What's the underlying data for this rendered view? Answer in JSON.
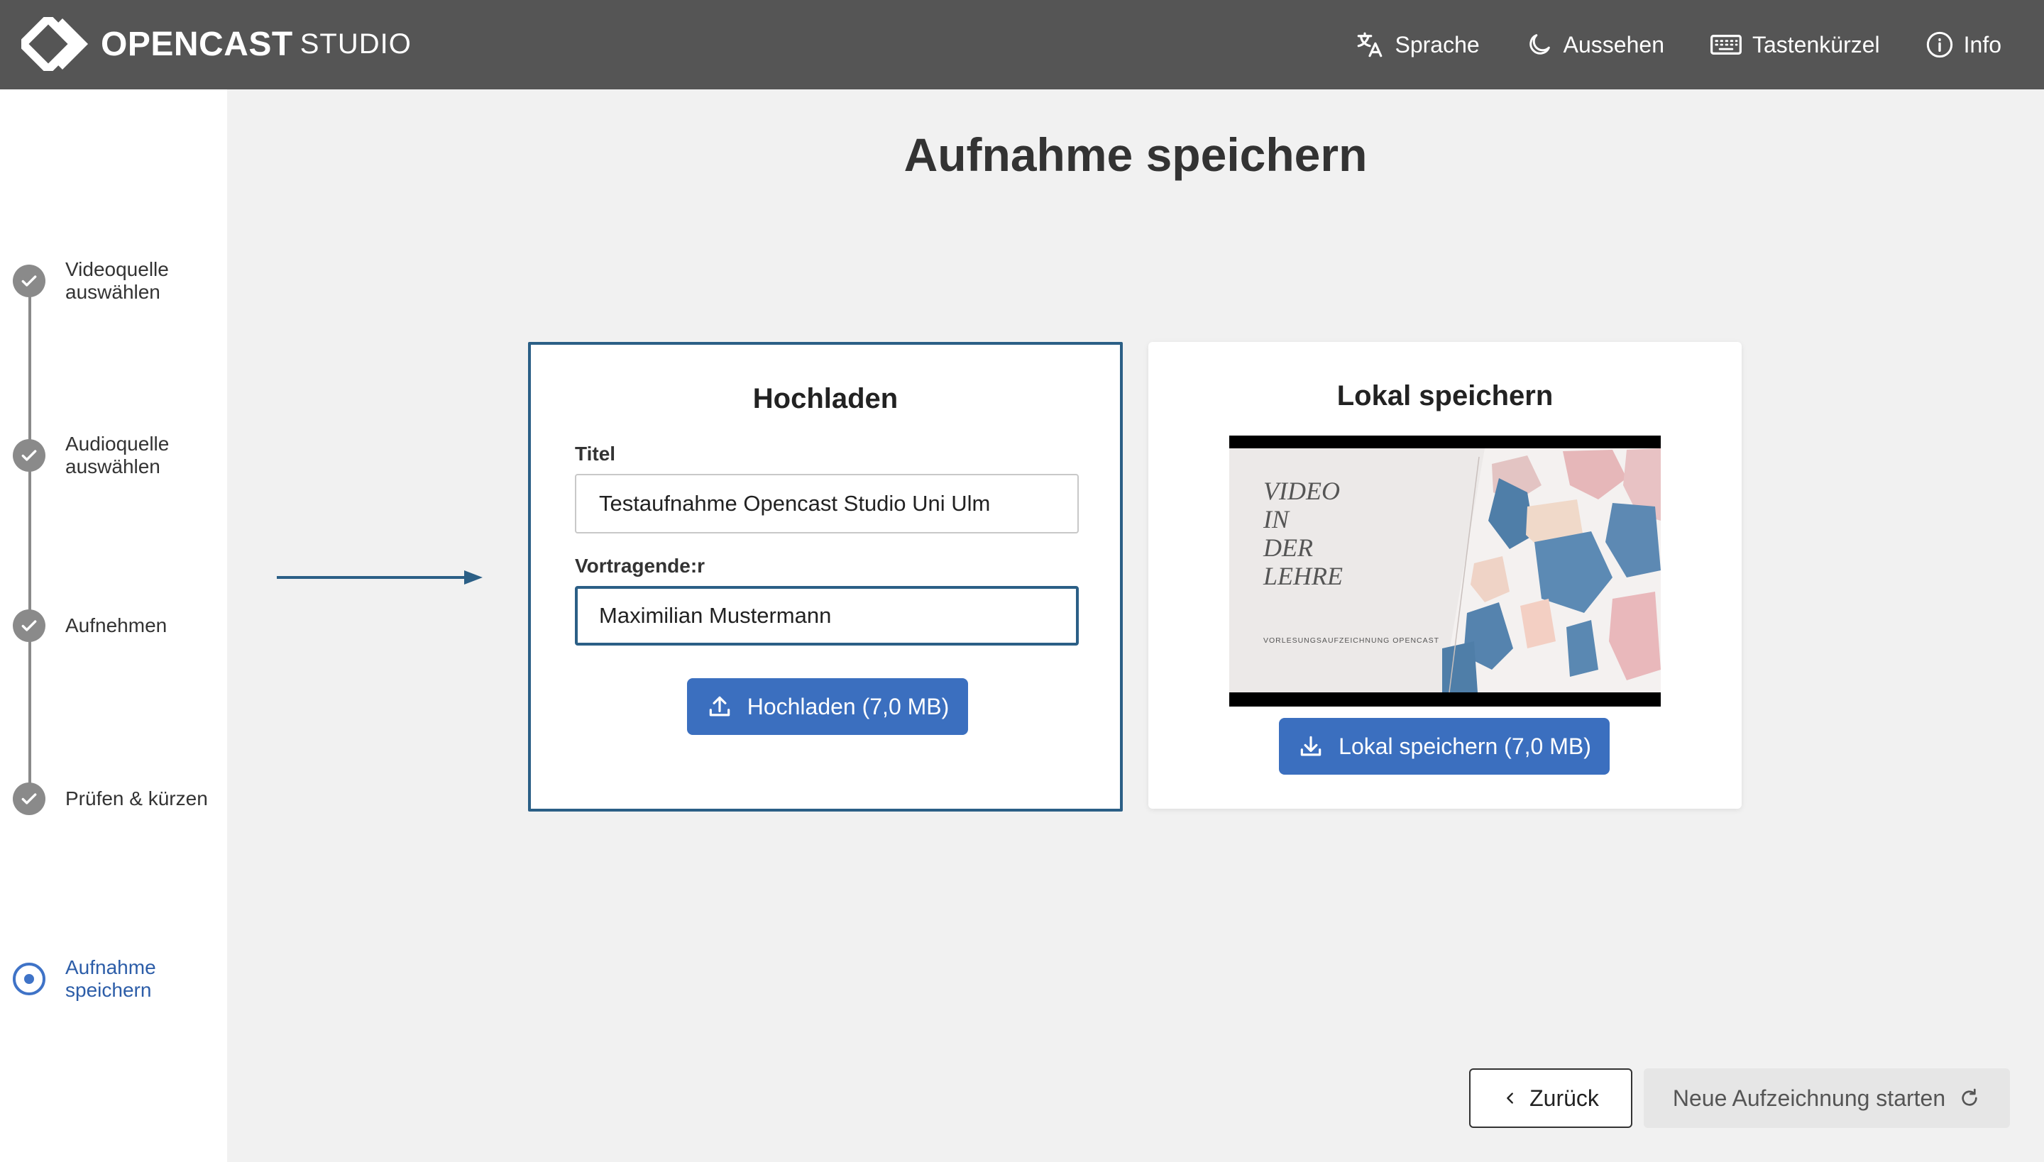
{
  "app": {
    "logo_text": "OPENCAST",
    "logo_sub": "STUDIO"
  },
  "nav": [
    {
      "label": "Sprache",
      "icon": "translate-icon"
    },
    {
      "label": "Aussehen",
      "icon": "moon-icon"
    },
    {
      "label": "Tastenkürzel",
      "icon": "keyboard-icon"
    },
    {
      "label": "Info",
      "icon": "info-icon"
    }
  ],
  "steps": [
    {
      "label": "Videoquelle auswählen",
      "state": "done"
    },
    {
      "label": "Audioquelle auswählen",
      "state": "done"
    },
    {
      "label": "Aufnehmen",
      "state": "done"
    },
    {
      "label": "Prüfen & kürzen",
      "state": "done"
    },
    {
      "label": "Aufnahme speichern",
      "state": "active"
    }
  ],
  "page_title": "Aufnahme speichern",
  "upload": {
    "title": "Hochladen",
    "title_label": "Titel",
    "title_value": "Testaufnahme Opencast Studio Uni Ulm",
    "presenter_label": "Vortragende:r",
    "presenter_value": "Maximilian Mustermann",
    "button_label": "Hochladen (7,0 MB)"
  },
  "local": {
    "title": "Lokal speichern",
    "thumbnail": {
      "line1": "VIDEO",
      "line2": "IN",
      "line3": "DER",
      "line4": "LEHRE",
      "caption": "VORLESUNGSAUFZEICHNUNG OPENCAST"
    },
    "button_label": "Lokal speichern (7,0 MB)"
  },
  "footer": {
    "back_label": "Zurück",
    "new_label": "Neue Aufzeichnung starten"
  },
  "colors": {
    "header_bg": "#555555",
    "primary": "#3b6fbf",
    "focus_border": "#2b5f86",
    "active_step": "#3f73c7"
  }
}
